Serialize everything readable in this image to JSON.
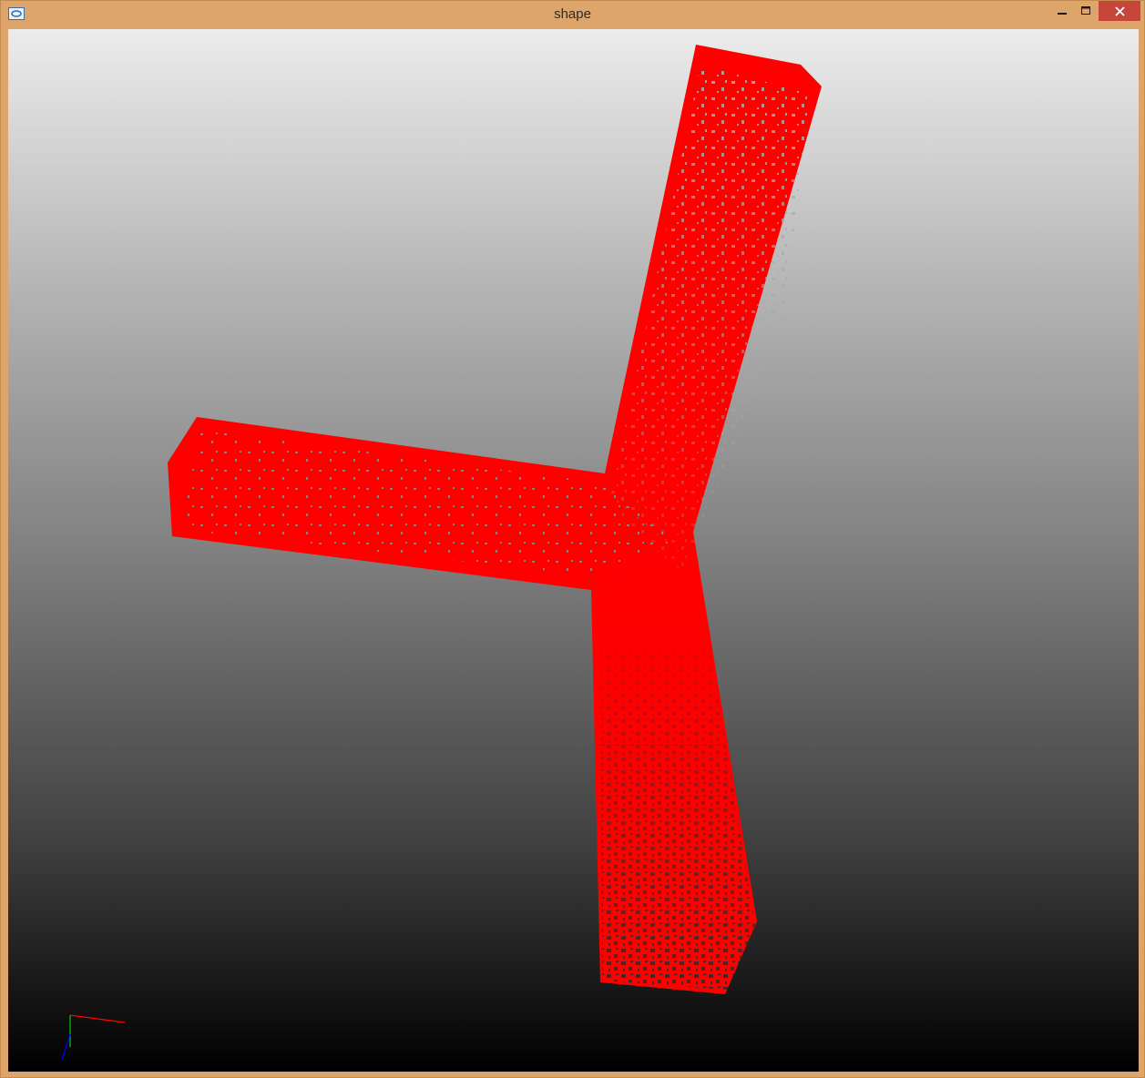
{
  "window": {
    "title": "shape",
    "icon": "app-icon",
    "controls": {
      "minimize": "minimize-icon",
      "maximize": "maximize-icon",
      "close": "close-icon"
    }
  },
  "scene": {
    "shape_color": "#ff0000",
    "hole_color_top": "#a9a9a9",
    "hole_color_bottom": "#2a2a2a",
    "background_top": "#ececec",
    "background_bottom": "#000000",
    "axes": {
      "x_color": "#ff0000",
      "y_color": "#00c000",
      "z_color": "#0000ff"
    }
  }
}
